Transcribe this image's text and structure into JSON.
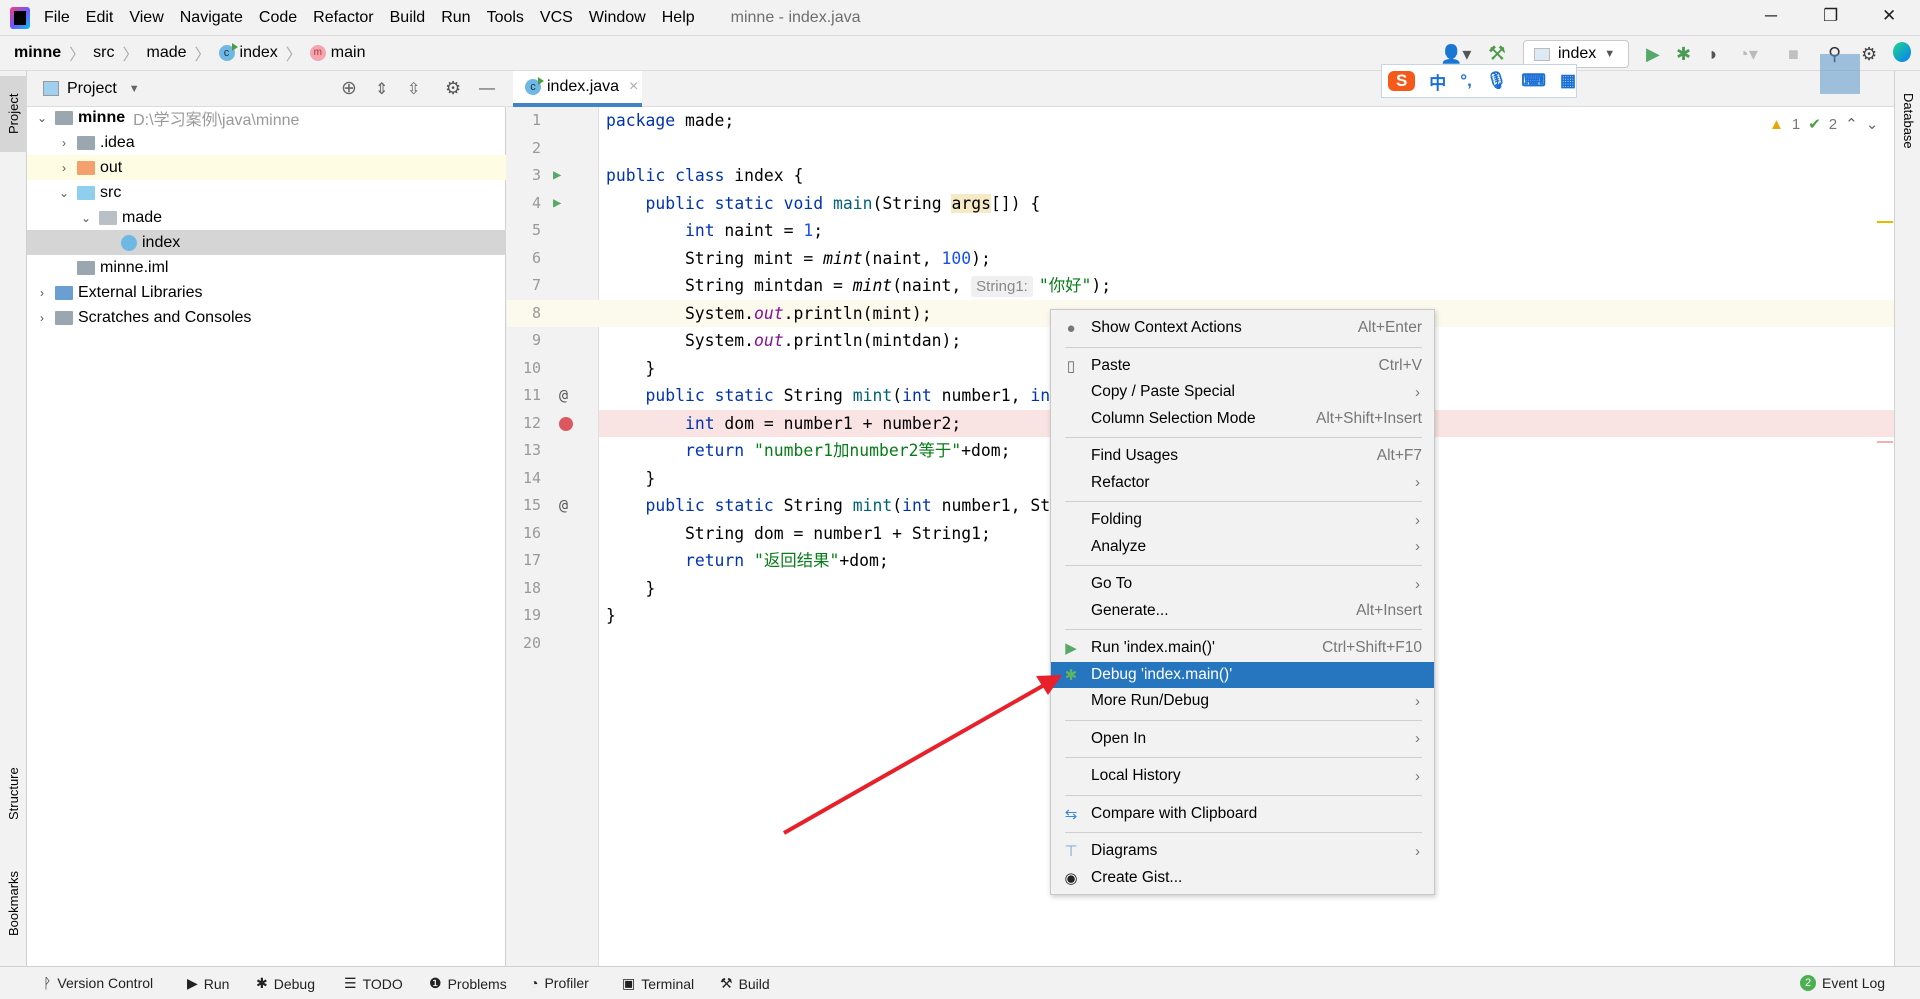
{
  "window": {
    "title": "minne - index.java",
    "minimize": "─",
    "restore": "❐",
    "close": "✕"
  },
  "menu": [
    "File",
    "Edit",
    "View",
    "Navigate",
    "Code",
    "Refactor",
    "Build",
    "Run",
    "Tools",
    "VCS",
    "Window",
    "Help"
  ],
  "breadcrumb": {
    "project": "minne",
    "items": [
      "src",
      "made"
    ],
    "class": "index",
    "class_icon": "c",
    "method": "main",
    "method_icon": "m"
  },
  "toolbar": {
    "run_config": "index",
    "icons": [
      "user-icon",
      "build-hammer-icon",
      "run-icon",
      "debug-icon",
      "coverage-icon",
      "profiler-icon",
      "stop-icon",
      "search-icon",
      "settings-icon",
      "jetbrains-icon"
    ],
    "run_color": "#59a869",
    "debug_color": "#499c54"
  },
  "ime": {
    "logo": "S",
    "mode": "中",
    "punct": "°,",
    "voice": "mic-icon",
    "keyboard": "keyboard-icon",
    "apps": "apps-icon"
  },
  "left_tabs": {
    "project": "Project",
    "structure": "Structure",
    "bookmarks": "Bookmarks"
  },
  "right_tabs": {
    "database": "Database"
  },
  "project": {
    "title": "Project",
    "tree": [
      {
        "label": "minne",
        "path": "D:\\学习案例\\java\\minne",
        "depth": 0,
        "arrow": "⌄",
        "icon": "module-folder",
        "bold": true
      },
      {
        "label": ".idea",
        "depth": 1,
        "arrow": "›",
        "icon": "folder"
      },
      {
        "label": "out",
        "depth": 1,
        "arrow": "›",
        "icon": "excluded-folder",
        "highlight": "#fefde3"
      },
      {
        "label": "src",
        "depth": 1,
        "arrow": "⌄",
        "icon": "source-folder"
      },
      {
        "label": "made",
        "depth": 2,
        "arrow": "⌄",
        "icon": "package"
      },
      {
        "label": "index",
        "depth": 3,
        "arrow": "",
        "icon": "class",
        "selected": true
      },
      {
        "label": "minne.iml",
        "depth": 1,
        "arrow": "",
        "icon": "iml-file"
      },
      {
        "label": "External Libraries",
        "depth": 0,
        "arrow": "›",
        "icon": "library"
      },
      {
        "label": "Scratches and Consoles",
        "depth": 0,
        "arrow": "›",
        "icon": "scratches"
      }
    ]
  },
  "editor": {
    "tab": "index.java",
    "tab_close": "×",
    "warnings": "1",
    "checks": "2",
    "caret_line": 8,
    "breakpoint_line": 12,
    "run_markers": [
      3,
      4
    ],
    "override_markers": [
      11,
      15
    ],
    "lines": [
      [
        [
          "package",
          "kw"
        ],
        [
          " made;",
          ""
        ]
      ],
      [],
      [
        [
          "public",
          "kw"
        ],
        [
          " ",
          ""
        ],
        [
          "class",
          "kw"
        ],
        [
          " index {",
          ""
        ]
      ],
      [
        [
          "    ",
          ""
        ],
        [
          "public",
          "kw"
        ],
        [
          " ",
          ""
        ],
        [
          "static",
          "kw"
        ],
        [
          " ",
          ""
        ],
        [
          "void",
          "kw"
        ],
        [
          " ",
          ""
        ],
        [
          "main",
          "fn"
        ],
        [
          "(String ",
          ""
        ],
        [
          "args",
          "hl"
        ],
        [
          "[]) {",
          ""
        ]
      ],
      [
        [
          "        ",
          ""
        ],
        [
          "int",
          "kw"
        ],
        [
          " naint = ",
          ""
        ],
        [
          "1",
          "num"
        ],
        [
          ";",
          ""
        ]
      ],
      [
        [
          "        String mint = ",
          ""
        ],
        [
          "mint",
          "it"
        ],
        [
          "(naint, ",
          ""
        ],
        [
          "100",
          "num"
        ],
        [
          ");",
          ""
        ]
      ],
      [
        [
          "        String mintdan = ",
          ""
        ],
        [
          "mint",
          "it"
        ],
        [
          "(naint, ",
          ""
        ],
        [
          "String1:",
          "hint"
        ],
        [
          "\"你好\"",
          "str"
        ],
        [
          ");",
          ""
        ]
      ],
      [
        [
          "        System.",
          ""
        ],
        [
          "out",
          "field"
        ],
        [
          ".println(mint);",
          ""
        ]
      ],
      [
        [
          "        System.",
          ""
        ],
        [
          "out",
          "field"
        ],
        [
          ".println(mintdan);",
          ""
        ]
      ],
      [
        [
          "    }",
          ""
        ]
      ],
      [
        [
          "    ",
          ""
        ],
        [
          "public",
          "kw"
        ],
        [
          " ",
          ""
        ],
        [
          "static",
          "kw"
        ],
        [
          " String ",
          ""
        ],
        [
          "mint",
          "fn"
        ],
        [
          "(",
          ""
        ],
        [
          "int",
          "kw"
        ],
        [
          " number1, ",
          ""
        ],
        [
          "in",
          "kw"
        ]
      ],
      [
        [
          "        ",
          ""
        ],
        [
          "int",
          "kw"
        ],
        [
          " dom = number1 + number2;",
          ""
        ]
      ],
      [
        [
          "        ",
          ""
        ],
        [
          "return",
          "kw"
        ],
        [
          " ",
          ""
        ],
        [
          "\"number1加number2等于\"",
          "str"
        ],
        [
          "+dom;",
          ""
        ]
      ],
      [
        [
          "    }",
          ""
        ]
      ],
      [
        [
          "    ",
          ""
        ],
        [
          "public",
          "kw"
        ],
        [
          " ",
          ""
        ],
        [
          "static",
          "kw"
        ],
        [
          " String ",
          ""
        ],
        [
          "mint",
          "fn"
        ],
        [
          "(",
          ""
        ],
        [
          "int",
          "kw"
        ],
        [
          " number1, St",
          ""
        ]
      ],
      [
        [
          "        String dom = number1 + String1;",
          ""
        ]
      ],
      [
        [
          "        ",
          ""
        ],
        [
          "return",
          "kw"
        ],
        [
          " ",
          ""
        ],
        [
          "\"返回结果\"",
          "str"
        ],
        [
          "+dom;",
          ""
        ]
      ],
      [
        [
          "    }",
          ""
        ]
      ],
      [
        [
          "}",
          ""
        ]
      ],
      []
    ]
  },
  "context_menu": [
    {
      "label": "Show Context Actions",
      "shortcut": "Alt+Enter",
      "icon": "lightbulb-icon",
      "sep": true
    },
    {
      "label": "Paste",
      "shortcut": "Ctrl+V",
      "icon": "clipboard-icon"
    },
    {
      "label": "Copy / Paste Special",
      "submenu": true
    },
    {
      "label": "Column Selection Mode",
      "shortcut": "Alt+Shift+Insert",
      "sep": true
    },
    {
      "label": "Find Usages",
      "shortcut": "Alt+F7"
    },
    {
      "label": "Refactor",
      "submenu": true,
      "sep": true
    },
    {
      "label": "Folding",
      "submenu": true
    },
    {
      "label": "Analyze",
      "submenu": true,
      "sep": true
    },
    {
      "label": "Go To",
      "submenu": true
    },
    {
      "label": "Generate...",
      "shortcut": "Alt+Insert",
      "sep": true
    },
    {
      "label": "Run 'index.main()'",
      "shortcut": "Ctrl+Shift+F10",
      "icon": "run-icon"
    },
    {
      "label": "Debug 'index.main()'",
      "icon": "debug-icon",
      "highlighted": true
    },
    {
      "label": "More Run/Debug",
      "submenu": true,
      "sep": true
    },
    {
      "label": "Open In",
      "submenu": true,
      "sep": true
    },
    {
      "label": "Local History",
      "submenu": true,
      "sep": true
    },
    {
      "label": "Compare with Clipboard",
      "icon": "compare-icon",
      "sep": true
    },
    {
      "label": "Diagrams",
      "submenu": true,
      "icon": "diagram-icon"
    },
    {
      "label": "Create Gist...",
      "icon": "github-icon"
    }
  ],
  "annotation": {
    "arrow_color": "#e8202a"
  },
  "status_bar": {
    "items": [
      {
        "label": "Version Control",
        "icon": "vcs-icon",
        "glyph": "ᚹ"
      },
      {
        "label": "Run",
        "icon": "run-icon",
        "glyph": "▶"
      },
      {
        "label": "Debug",
        "icon": "debug-icon",
        "glyph": "✱"
      },
      {
        "label": "TODO",
        "icon": "todo-icon",
        "glyph": "☰"
      },
      {
        "label": "Problems",
        "icon": "problems-icon",
        "glyph": "❶"
      },
      {
        "label": "Profiler",
        "icon": "profiler-icon",
        "glyph": "◔"
      },
      {
        "label": "Terminal",
        "icon": "terminal-icon",
        "glyph": "▣"
      },
      {
        "label": "Build",
        "icon": "build-icon",
        "glyph": "⚒"
      }
    ],
    "event_log": "Event Log",
    "event_count": "2"
  }
}
